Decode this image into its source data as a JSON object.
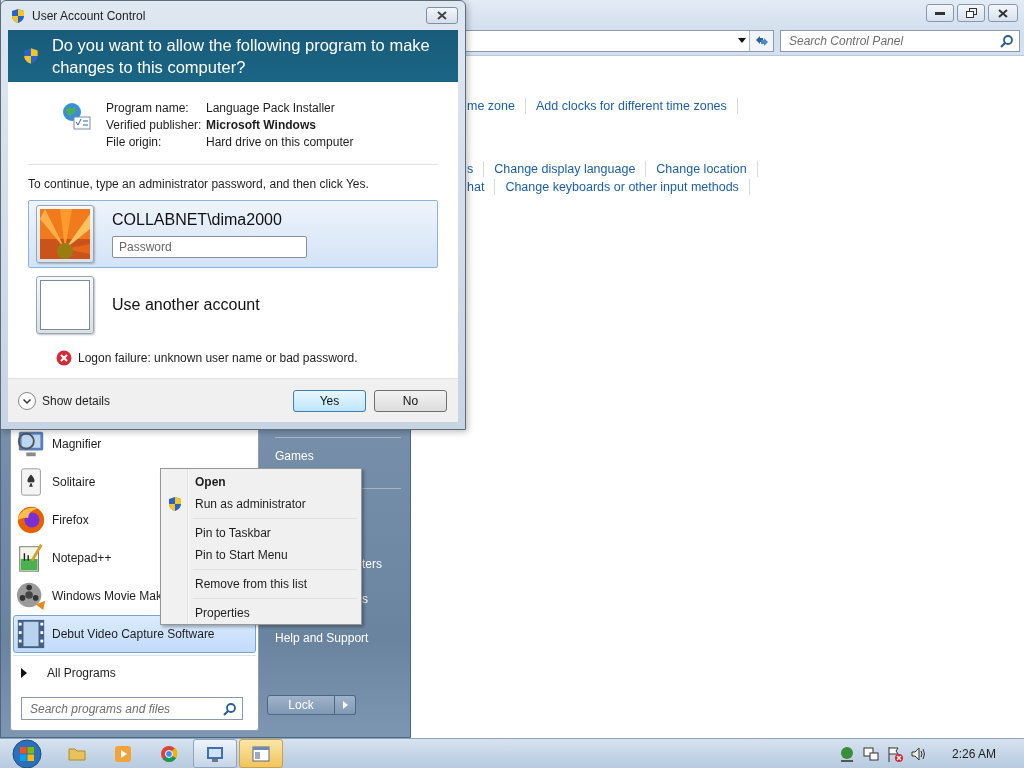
{
  "control_panel": {
    "search": {
      "placeholder": "Search Control Panel"
    },
    "link_rows": [
      [
        "me zone",
        "Add clocks for different time zones"
      ],
      [
        "s",
        "Change display language",
        "Change location"
      ],
      [
        "hat",
        "Change keyboards or other input methods"
      ]
    ]
  },
  "uac": {
    "title": "User Account Control",
    "heading": "Do you want to allow the following program to make changes to this computer?",
    "fields": [
      {
        "label": "Program name:",
        "value": "Language Pack Installer",
        "bold": false
      },
      {
        "label": "Verified publisher:",
        "value": "Microsoft Windows",
        "bold": true
      },
      {
        "label": "File origin:",
        "value": "Hard drive on this computer",
        "bold": false
      }
    ],
    "instruction": "To continue, type an administrator password, and then click Yes.",
    "accounts": [
      {
        "name": "COLLABNET\\dima2000",
        "selected": true,
        "kind": "user",
        "password": {
          "placeholder": "Password"
        }
      },
      {
        "name": "Use another account",
        "selected": false,
        "kind": "other"
      }
    ],
    "error": "Logon failure: unknown user name or bad password.",
    "show_details": "Show details",
    "buttons": [
      {
        "label": "Yes",
        "default": true
      },
      {
        "label": "No",
        "default": false
      }
    ]
  },
  "start_menu": {
    "programs": [
      {
        "label": "Magnifier",
        "kind": "magnifier",
        "selected": false
      },
      {
        "label": "Solitaire",
        "kind": "cards",
        "selected": false
      },
      {
        "label": "Firefox",
        "kind": "firefox",
        "selected": false
      },
      {
        "label": "Notepad++",
        "kind": "notepad",
        "selected": false
      },
      {
        "label": "Windows Movie Mak",
        "kind": "reel",
        "selected": false
      },
      {
        "label": "Debut Video Capture Software",
        "kind": "film",
        "selected": true
      }
    ],
    "all_programs": "All Programs",
    "search": {
      "placeholder": "Search programs and files"
    },
    "right_items": [
      {
        "label": "Games",
        "kind": "full"
      },
      {
        "label": "ters",
        "kind": "fragment"
      },
      {
        "label": "s",
        "kind": "fragment"
      },
      {
        "label": "Help and Support",
        "kind": "full"
      }
    ],
    "lock": "Lock"
  },
  "context_menu": {
    "groups": [
      [
        {
          "label": "Open",
          "default": true,
          "shield": false
        },
        {
          "label": "Run as administrator",
          "default": false,
          "shield": true
        }
      ],
      [
        {
          "label": "Pin to Taskbar",
          "default": false,
          "shield": false
        },
        {
          "label": "Pin to Start Menu",
          "default": false,
          "shield": false
        }
      ],
      [
        {
          "label": "Remove from this list",
          "default": false,
          "shield": false
        }
      ],
      [
        {
          "label": "Properties",
          "default": false,
          "shield": false
        }
      ]
    ]
  },
  "taskbar": {
    "apps": [
      {
        "kind": "folder",
        "open": false,
        "flashing": false
      },
      {
        "kind": "media",
        "open": false,
        "flashing": false
      },
      {
        "kind": "browser",
        "open": false,
        "flashing": false
      },
      {
        "kind": "control-panel",
        "open": true,
        "flashing": false
      },
      {
        "kind": "window",
        "open": true,
        "flashing": true
      }
    ],
    "clock": "2:26 AM"
  }
}
